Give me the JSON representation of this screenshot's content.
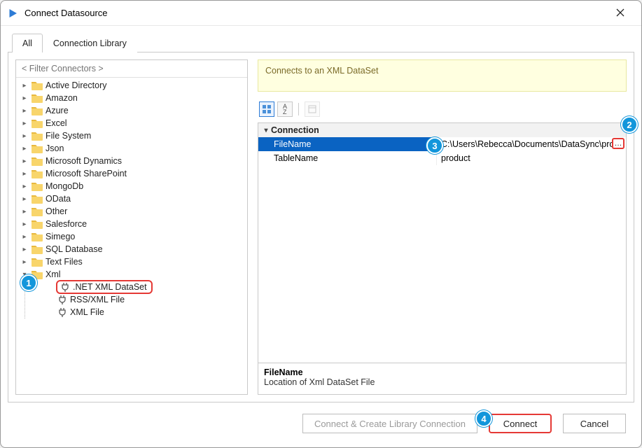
{
  "window": {
    "title": "Connect Datasource"
  },
  "tabs": {
    "all": "All",
    "library": "Connection Library",
    "active": "all"
  },
  "left": {
    "filter_placeholder": "< Filter Connectors >",
    "folders": [
      "Active Directory",
      "Amazon",
      "Azure",
      "Excel",
      "File System",
      "Json",
      "Microsoft Dynamics",
      "Microsoft SharePoint",
      "MongoDb",
      "OData",
      "Other",
      "Salesforce",
      "Simego",
      "SQL Database",
      "Text Files"
    ],
    "xml_folder": "Xml",
    "xml_children": [
      ".NET XML DataSet",
      "RSS/XML File",
      "XML File"
    ],
    "xml_selected_index": 0
  },
  "right": {
    "description": "Connects to an XML DataSet",
    "category": "Connection",
    "props": [
      {
        "name": "FileName",
        "value": "C:\\Users\\Rebecca\\Documents\\DataSync\\pro",
        "selected": true,
        "browse": true
      },
      {
        "name": "TableName",
        "value": "product",
        "selected": false,
        "browse": false
      }
    ],
    "help_title": "FileName",
    "help_desc": "Location of Xml DataSet File"
  },
  "buttons": {
    "create_library": "Connect & Create Library Connection",
    "connect": "Connect",
    "cancel": "Cancel"
  },
  "callouts": {
    "c1": "1",
    "c2": "2",
    "c3": "3",
    "c4": "4"
  }
}
